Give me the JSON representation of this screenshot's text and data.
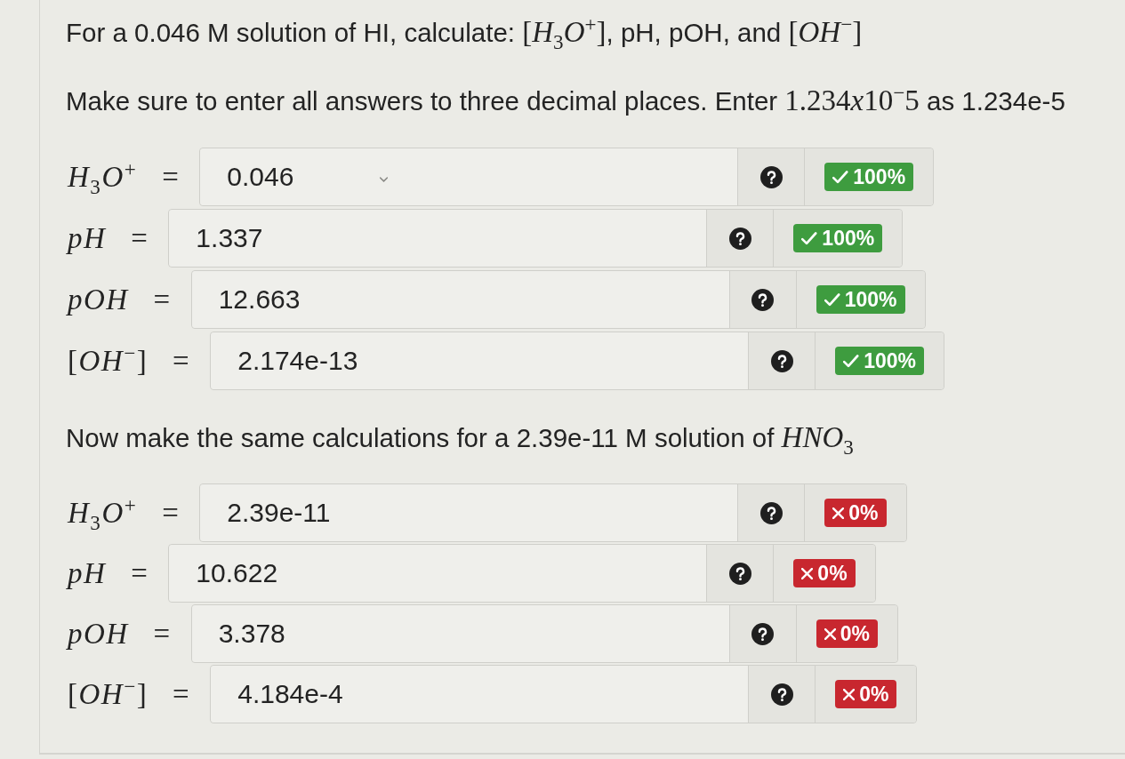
{
  "sections": [
    {
      "paragraphs": [
        [
          {
            "kind": "text",
            "text": "For a 0.046 M solution of HI, calculate: "
          },
          {
            "kind": "math",
            "text": "[*H*$_{3}$*O*$^{+}$]"
          },
          {
            "kind": "text",
            "text": ", pH, pOH, and "
          },
          {
            "kind": "math",
            "text": "[*OH*$^{−}$]"
          }
        ],
        [
          {
            "kind": "text",
            "text": "Make sure to enter all answers to three decimal places. Enter "
          },
          {
            "kind": "math",
            "text": "1.234"
          },
          {
            "kind": "var",
            "text": "x"
          },
          {
            "kind": "math",
            "text": "10$^{−}$5"
          },
          {
            "kind": "text",
            "text": " as 1.234e-5"
          }
        ]
      ],
      "rows": [
        {
          "label": "*H*$_{3}$*O*$^{+}$ =",
          "value": "0.046",
          "caret": true,
          "correct": true,
          "score": "100%"
        },
        {
          "label": "*pH* =",
          "value": "1.337",
          "caret": false,
          "correct": true,
          "score": "100%"
        },
        {
          "label": "*pOH* =",
          "value": "12.663",
          "caret": false,
          "correct": true,
          "score": "100%"
        },
        {
          "label": "[*OH*$^{−}$] =",
          "value": "2.174e-13",
          "caret": false,
          "correct": true,
          "score": "100%"
        }
      ]
    },
    {
      "paragraphs": [
        [
          {
            "kind": "text",
            "text": "Now make the same calculations for a 2.39e-11 M solution of "
          },
          {
            "kind": "math",
            "text": "*HNO*$_{3}$"
          }
        ]
      ],
      "rows": [
        {
          "label": "*H*$_{3}$*O*$^{+}$ =",
          "value": "2.39e-11",
          "caret": false,
          "correct": false,
          "score": "0%"
        },
        {
          "label": "*pH* =",
          "value": "10.622",
          "caret": false,
          "correct": false,
          "score": "0%"
        },
        {
          "label": "*pOH* =",
          "value": "3.378",
          "caret": false,
          "correct": false,
          "score": "0%"
        },
        {
          "label": "[*OH*$^{−}$] =",
          "value": "4.184e-4",
          "caret": false,
          "correct": false,
          "score": "0%"
        }
      ]
    }
  ]
}
